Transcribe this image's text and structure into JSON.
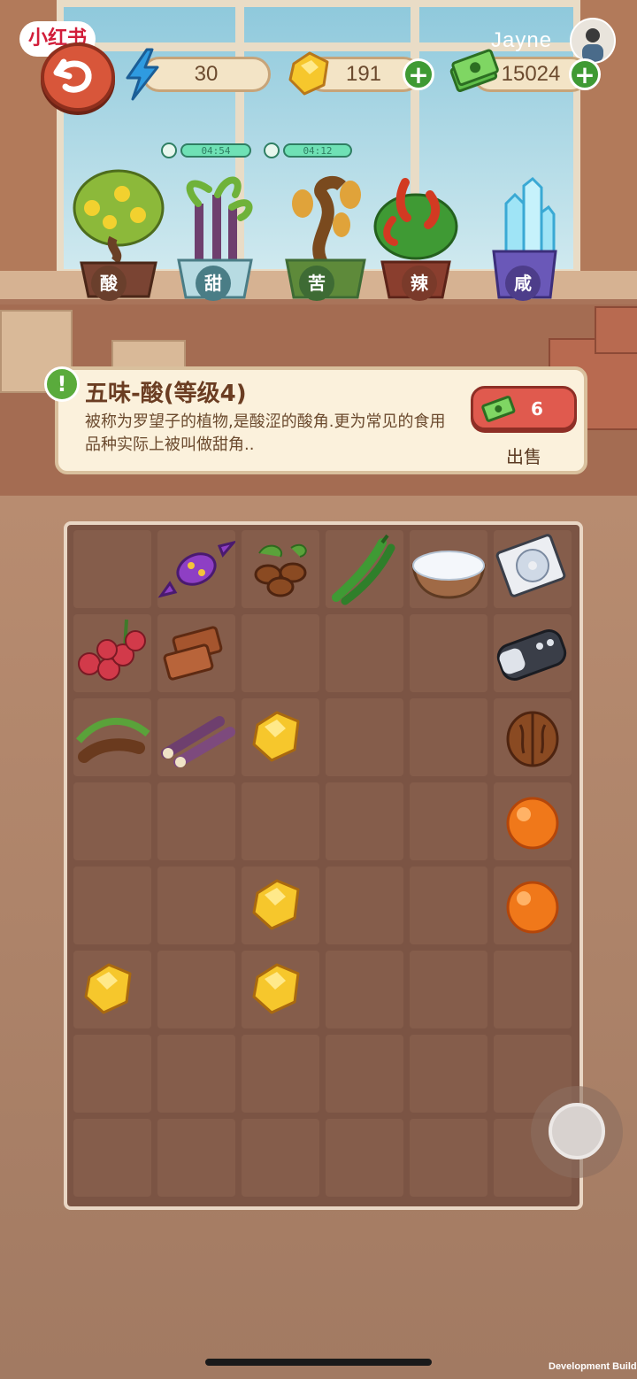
{
  "app_badge": "小红书",
  "user": {
    "name": "Jayne"
  },
  "resources": {
    "energy": {
      "icon": "lightning-icon",
      "value": "30"
    },
    "gems": {
      "icon": "gem-icon",
      "value": "191",
      "plus": "+"
    },
    "cash": {
      "icon": "cash-icon",
      "value": "15024",
      "plus": "+"
    }
  },
  "timers": [
    {
      "value": "04:54"
    },
    {
      "value": "04:12"
    }
  ],
  "plants": [
    {
      "label": "酸",
      "color": "#6a3f2c"
    },
    {
      "label": "甜",
      "color": "#4a7d86"
    },
    {
      "label": "苦",
      "color": "#3e6b34"
    },
    {
      "label": "辣",
      "color": "#7a3a2a"
    },
    {
      "label": "咸",
      "color": "#4d3d8a"
    }
  ],
  "info": {
    "alert": "!",
    "title": "五味-酸(等级4)",
    "description": "被称为罗望子的植物,是酸涩的酸角.更为常见的食用品种实际上被叫做甜角..",
    "sell_value": "6",
    "sell_label": "出售"
  },
  "grid_items": [
    {
      "row": 0,
      "col": 1,
      "name": "candy-item"
    },
    {
      "row": 0,
      "col": 2,
      "name": "coffee-beans-item"
    },
    {
      "row": 0,
      "col": 3,
      "name": "green-chili-item"
    },
    {
      "row": 0,
      "col": 4,
      "name": "salt-bowl-item"
    },
    {
      "row": 0,
      "col": 5,
      "name": "cd-case-item"
    },
    {
      "row": 1,
      "col": 0,
      "name": "lychee-item"
    },
    {
      "row": 1,
      "col": 1,
      "name": "brown-sugar-item"
    },
    {
      "row": 1,
      "col": 5,
      "name": "car-key-item"
    },
    {
      "row": 2,
      "col": 0,
      "name": "tamarind-item"
    },
    {
      "row": 2,
      "col": 1,
      "name": "sugarcane-item"
    },
    {
      "row": 2,
      "col": 2,
      "name": "gem-item"
    },
    {
      "row": 2,
      "col": 5,
      "name": "walnut-item"
    },
    {
      "row": 3,
      "col": 5,
      "name": "orange-orb-item"
    },
    {
      "row": 4,
      "col": 2,
      "name": "gem-item"
    },
    {
      "row": 4,
      "col": 5,
      "name": "orange-orb-item"
    },
    {
      "row": 5,
      "col": 0,
      "name": "gem-item"
    },
    {
      "row": 5,
      "col": 2,
      "name": "gem-item"
    }
  ],
  "footer": {
    "dev_build": "Development Build"
  }
}
